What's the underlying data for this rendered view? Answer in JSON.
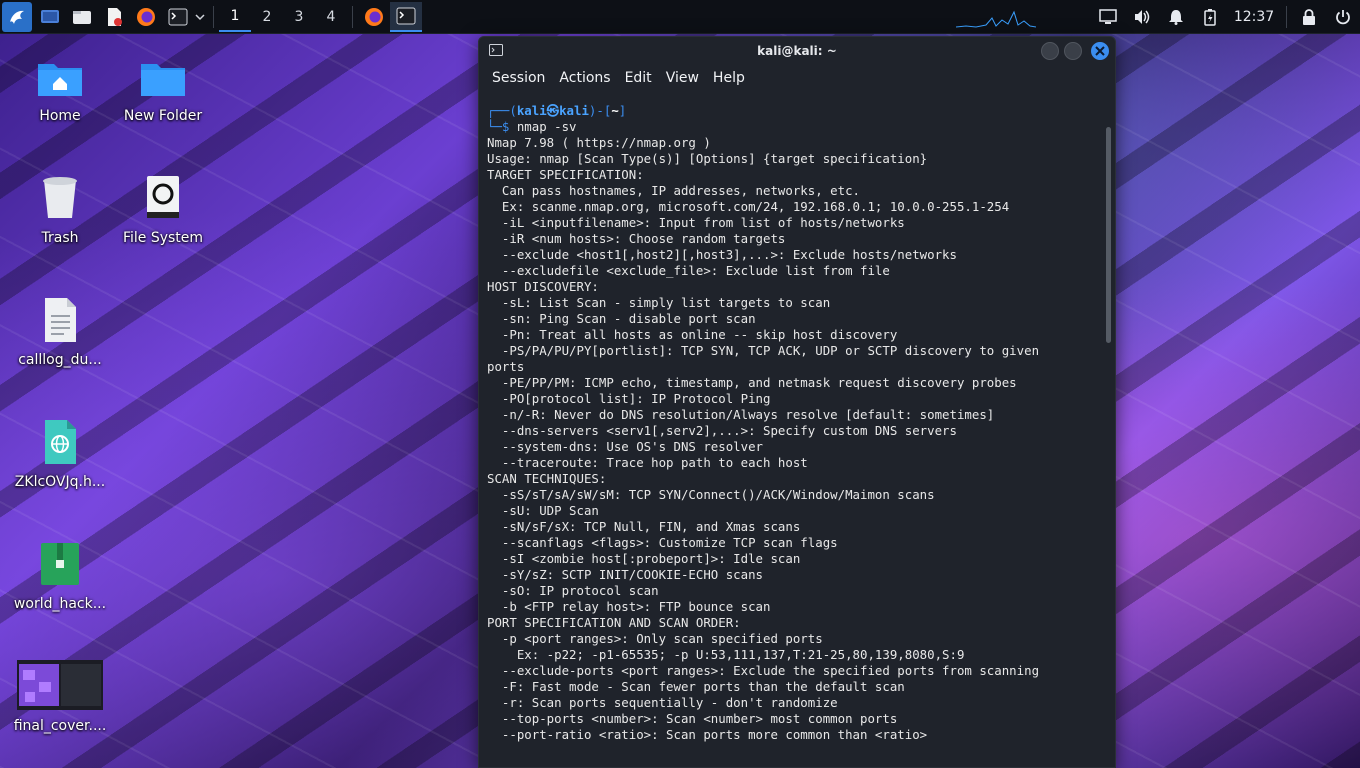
{
  "taskbar": {
    "workspaces": [
      "1",
      "2",
      "3",
      "4"
    ],
    "active_workspace": "1",
    "clock": "12:37"
  },
  "desktop": {
    "icons": [
      {
        "label": "Home"
      },
      {
        "label": "New Folder"
      },
      {
        "label": "Trash"
      },
      {
        "label": "File System"
      },
      {
        "label": "calllog_du..."
      },
      {
        "label": "ZKlcOVJq.h..."
      },
      {
        "label": "world_hack..."
      },
      {
        "label": "final_cover...."
      }
    ]
  },
  "terminal": {
    "title": "kali@kali: ~",
    "menu": [
      "Session",
      "Actions",
      "Edit",
      "View",
      "Help"
    ],
    "prompt": {
      "pre": "┌──(",
      "user": "kali㉿kali",
      "mid": ")-[",
      "dir": "~",
      "post": "]"
    },
    "prompt_cmd_prefix": "└─$ ",
    "command": "nmap -sv",
    "output": [
      "Nmap 7.98 ( https://nmap.org )",
      "Usage: nmap [Scan Type(s)] [Options] {target specification}",
      "TARGET SPECIFICATION:",
      "  Can pass hostnames, IP addresses, networks, etc.",
      "  Ex: scanme.nmap.org, microsoft.com/24, 192.168.0.1; 10.0.0-255.1-254",
      "  -iL <inputfilename>: Input from list of hosts/networks",
      "  -iR <num hosts>: Choose random targets",
      "  --exclude <host1[,host2][,host3],...>: Exclude hosts/networks",
      "  --excludefile <exclude_file>: Exclude list from file",
      "HOST DISCOVERY:",
      "  -sL: List Scan - simply list targets to scan",
      "  -sn: Ping Scan - disable port scan",
      "  -Pn: Treat all hosts as online -- skip host discovery",
      "  -PS/PA/PU/PY[portlist]: TCP SYN, TCP ACK, UDP or SCTP discovery to given",
      "ports",
      "  -PE/PP/PM: ICMP echo, timestamp, and netmask request discovery probes",
      "  -PO[protocol list]: IP Protocol Ping",
      "  -n/-R: Never do DNS resolution/Always resolve [default: sometimes]",
      "  --dns-servers <serv1[,serv2],...>: Specify custom DNS servers",
      "  --system-dns: Use OS's DNS resolver",
      "  --traceroute: Trace hop path to each host",
      "SCAN TECHNIQUES:",
      "  -sS/sT/sA/sW/sM: TCP SYN/Connect()/ACK/Window/Maimon scans",
      "  -sU: UDP Scan",
      "  -sN/sF/sX: TCP Null, FIN, and Xmas scans",
      "  --scanflags <flags>: Customize TCP scan flags",
      "  -sI <zombie host[:probeport]>: Idle scan",
      "  -sY/sZ: SCTP INIT/COOKIE-ECHO scans",
      "  -sO: IP protocol scan",
      "  -b <FTP relay host>: FTP bounce scan",
      "PORT SPECIFICATION AND SCAN ORDER:",
      "  -p <port ranges>: Only scan specified ports",
      "    Ex: -p22; -p1-65535; -p U:53,111,137,T:21-25,80,139,8080,S:9",
      "  --exclude-ports <port ranges>: Exclude the specified ports from scanning",
      "  -F: Fast mode - Scan fewer ports than the default scan",
      "  -r: Scan ports sequentially - don't randomize",
      "  --top-ports <number>: Scan <number> most common ports",
      "  --port-ratio <ratio>: Scan ports more common than <ratio>"
    ]
  },
  "colors": {
    "accent": "#3b8ef0",
    "terminal_bg": "#1f232b",
    "taskbar_bg": "#0d1016"
  }
}
